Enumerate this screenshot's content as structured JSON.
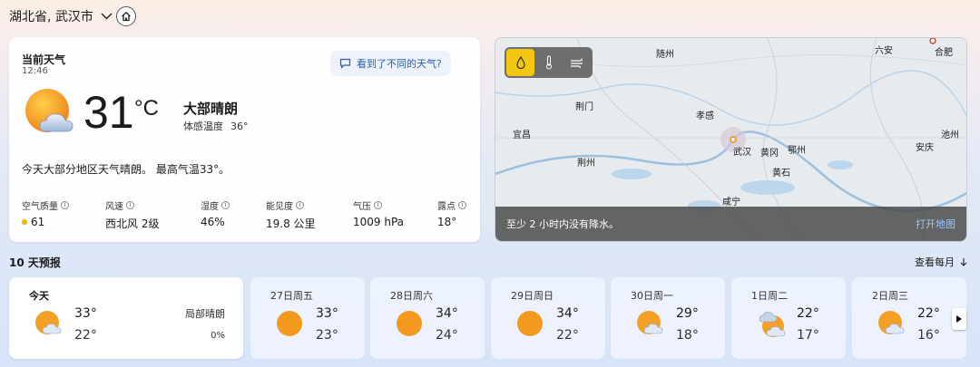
{
  "location": {
    "name": "湖北省, 武汉市",
    "chevron_icon": "chevron-down-icon",
    "home_icon": "home-icon"
  },
  "current": {
    "title": "当前天气",
    "time": "12:46",
    "feedback_label": "看到了不同的天气?",
    "temperature": "31",
    "unit": "°C",
    "condition": "大部晴朗",
    "feels_label": "体感温度",
    "feels_value": "36°",
    "summary": "今天大部分地区天气晴朗。 最高气温33°。",
    "details": [
      {
        "label": "空气质量",
        "value": "61"
      },
      {
        "label": "风速",
        "value": "西北风 2级"
      },
      {
        "label": "湿度",
        "value": "46%"
      },
      {
        "label": "能见度",
        "value": "19.8 公里"
      },
      {
        "label": "气压",
        "value": "1009 hPa"
      },
      {
        "label": "露点",
        "value": "18°"
      }
    ]
  },
  "map": {
    "tools": [
      "precipitation-icon",
      "temperature-icon",
      "wind-icon"
    ],
    "cities": [
      "随州",
      "六安",
      "合肥",
      "荆门",
      "孝感",
      "宜昌",
      "武汉",
      "黄冈",
      "鄂州",
      "池州",
      "安庆",
      "荆州",
      "黄石",
      "咸宁"
    ],
    "footer_text": "至少 2 小时内没有降水。",
    "open_label": "打开地图"
  },
  "forecast": {
    "title": "10 天预报",
    "monthly_label": "查看每月",
    "today": {
      "name": "今天",
      "hi": "33°",
      "lo": "22°",
      "condition": "局部晴朗",
      "precip": "0%"
    },
    "days": [
      {
        "name": "27日周五",
        "hi": "33°",
        "lo": "23°",
        "icon": "sunny-icon"
      },
      {
        "name": "28日周六",
        "hi": "34°",
        "lo": "24°",
        "icon": "sunny-icon"
      },
      {
        "name": "29日周日",
        "hi": "34°",
        "lo": "22°",
        "icon": "sunny-icon"
      },
      {
        "name": "30日周一",
        "hi": "29°",
        "lo": "18°",
        "icon": "partly-cloudy-icon"
      },
      {
        "name": "1日周二",
        "hi": "22°",
        "lo": "17°",
        "icon": "cloudy-icon"
      },
      {
        "name": "2日周三",
        "hi": "22°",
        "lo": "16°",
        "icon": "partly-cloudy-icon"
      }
    ]
  },
  "colors": {
    "sun": "#f39a1e",
    "accent": "#2a5db0",
    "active_tool": "#f3c612"
  }
}
